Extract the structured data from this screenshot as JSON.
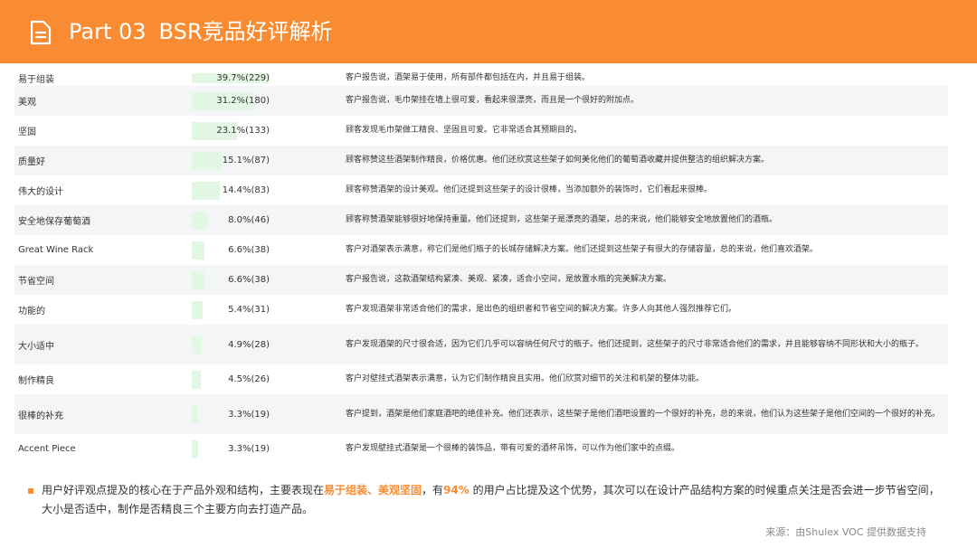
{
  "header": {
    "part": "Part 03",
    "title": "BSR竞品好评解析",
    "icon": "document-icon",
    "accent_color": "#f98c32"
  },
  "table": {
    "bar_color": "#e2f7e4",
    "rows": [
      {
        "label": "易于组装",
        "share": 39.7,
        "value": "39.7%(229)",
        "desc": "客户报告说，酒架易于使用，所有部件都包括在内，并且易于组装。"
      },
      {
        "label": "美观",
        "share": 31.2,
        "value": "31.2%(180)",
        "desc": "客户报告说，毛巾架挂在墙上很可爱，看起来很漂亮，而且是一个很好的附加点。"
      },
      {
        "label": "坚固",
        "share": 23.1,
        "value": "23.1%(133)",
        "desc": "顾客发现毛巾架做工精良、坚固且可爱。它非常适合其预期目的。"
      },
      {
        "label": "质量好",
        "share": 15.1,
        "value": "15.1%(87)",
        "desc": "顾客称赞这些酒架制作精良，价格优惠。他们还欣赏这些架子如何美化他们的葡萄酒收藏并提供整洁的组织解决方案。"
      },
      {
        "label": "伟大的设计",
        "share": 14.4,
        "value": "14.4%(83)",
        "desc": "顾客称赞酒架的设计美观。他们还提到这些架子的设计很棒，当添加额外的装饰时，它们看起来很棒。"
      },
      {
        "label": "安全地保存葡萄酒",
        "share": 8.0,
        "value": "8.0%(46)",
        "desc": "顾客称赞酒架能够很好地保持重量。他们还提到，这些架子是漂亮的酒架，总的来说，他们能够安全地放置他们的酒瓶。"
      },
      {
        "label": "Great Wine Rack",
        "share": 6.6,
        "value": "6.6%(38)",
        "desc": "客户对酒架表示满意，称它们是他们瓶子的长城存储解决方案。他们还提到这些架子有很大的存储容量，总的来说，他们喜欢酒架。"
      },
      {
        "label": "节省空间",
        "share": 6.6,
        "value": "6.6%(38)",
        "desc": "客户报告说，这款酒架结构紧凑、美观、紧凑，适合小空间，是放置水瓶的完美解决方案。"
      },
      {
        "label": "功能的",
        "share": 5.4,
        "value": "5.4%(31)",
        "desc": "客户发现酒架非常适合他们的需求，是出色的组织者和节省空间的解决方案。许多人向其他人强烈推荐它们。"
      },
      {
        "label": "大小适中",
        "share": 4.9,
        "value": "4.9%(28)",
        "desc": "客户发现酒架的尺寸很合适，因为它们几乎可以容纳任何尺寸的瓶子。他们还提到，这些架子的尺寸非常适合他们的需求，并且能够容纳不同形状和大小的瓶子。"
      },
      {
        "label": "制作精良",
        "share": 4.5,
        "value": "4.5%(26)",
        "desc": "客户对壁挂式酒架表示满意，认为它们制作精良且实用。他们欣赏对细节的关注和机架的整体功能。"
      },
      {
        "label": "很棒的补充",
        "share": 3.3,
        "value": "3.3%(19)",
        "desc": "客户提到，酒架是他们家庭酒吧的绝佳补充。他们还表示，这些架子是他们酒吧设置的一个很好的补充，总的来说，他们认为这些架子是他们空间的一个很好的补充。"
      },
      {
        "label": "Accent Piece",
        "share": 3.3,
        "value": "3.3%(19)",
        "desc": "客户发现壁挂式酒架是一个很棒的装饰品，带有可爱的酒杯吊饰，可以作为他们家中的点缀。"
      }
    ]
  },
  "summary": {
    "part1": "用户好评观点提及的核心在于产品外观和结构，主要表现在",
    "highlight1": "易于组装、美观坚固",
    "part2": "，有",
    "highlight2": "94%",
    "part3": " 的用户占比提及这个优势，其次可以在设计产品结构方案的时候重点关注是否会进一步节省空间，大小是否适中，制作是否精良三个主要方向去打造产品。"
  },
  "source": "来源：由Shulex VOC 提供数据支持"
}
